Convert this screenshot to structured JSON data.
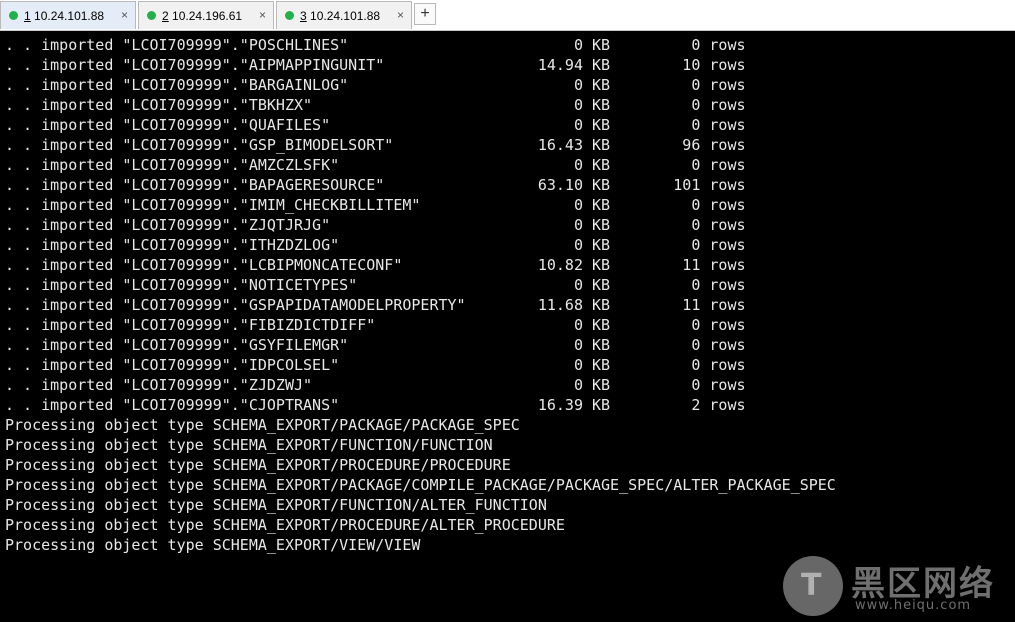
{
  "tabs": [
    {
      "num": "1",
      "host": "10.24.101.88",
      "status_color": "#22b04a",
      "active": true,
      "close": "×"
    },
    {
      "num": "2",
      "host": "10.24.196.61",
      "status_color": "#22b04a",
      "active": false,
      "close": "×"
    },
    {
      "num": "3",
      "host": "10.24.101.88",
      "status_color": "#22b04a",
      "active": false,
      "close": "×"
    }
  ],
  "add_tab_label": "+",
  "imports": [
    {
      "table": "POSCHLINES",
      "size": "0 KB",
      "rows": "0"
    },
    {
      "table": "AIPMAPPINGUNIT",
      "size": "14.94 KB",
      "rows": "10"
    },
    {
      "table": "BARGAINLOG",
      "size": "0 KB",
      "rows": "0"
    },
    {
      "table": "TBKHZX",
      "size": "0 KB",
      "rows": "0"
    },
    {
      "table": "QUAFILES",
      "size": "0 KB",
      "rows": "0"
    },
    {
      "table": "GSP_BIMODELSORT",
      "size": "16.43 KB",
      "rows": "96"
    },
    {
      "table": "AMZCZLSFK",
      "size": "0 KB",
      "rows": "0"
    },
    {
      "table": "BAPAGERESOURCE",
      "size": "63.10 KB",
      "rows": "101"
    },
    {
      "table": "IMIM_CHECKBILLITEM",
      "size": "0 KB",
      "rows": "0"
    },
    {
      "table": "ZJQTJRJG",
      "size": "0 KB",
      "rows": "0"
    },
    {
      "table": "ITHZDZLOG",
      "size": "0 KB",
      "rows": "0"
    },
    {
      "table": "LCBIPMONCATECONF",
      "size": "10.82 KB",
      "rows": "11"
    },
    {
      "table": "NOTICETYPES",
      "size": "0 KB",
      "rows": "0"
    },
    {
      "table": "GSPAPIDATAMODELPROPERTY",
      "size": "11.68 KB",
      "rows": "11"
    },
    {
      "table": "FIBIZDICTDIFF",
      "size": "0 KB",
      "rows": "0"
    },
    {
      "table": "GSYFILEMGR",
      "size": "0 KB",
      "rows": "0"
    },
    {
      "table": "IDPCOLSEL",
      "size": "0 KB",
      "rows": "0"
    },
    {
      "table": "ZJDZWJ",
      "size": "0 KB",
      "rows": "0"
    },
    {
      "table": "CJOPTRANS",
      "size": "16.39 KB",
      "rows": "2"
    }
  ],
  "import_prefix": ". . imported",
  "schema": "LCOI709999",
  "rows_suffix": "rows",
  "processing_prefix": "Processing object type",
  "processing": [
    "SCHEMA_EXPORT/PACKAGE/PACKAGE_SPEC",
    "SCHEMA_EXPORT/FUNCTION/FUNCTION",
    "SCHEMA_EXPORT/PROCEDURE/PROCEDURE",
    "SCHEMA_EXPORT/PACKAGE/COMPILE_PACKAGE/PACKAGE_SPEC/ALTER_PACKAGE_SPEC",
    "SCHEMA_EXPORT/FUNCTION/ALTER_FUNCTION",
    "SCHEMA_EXPORT/PROCEDURE/ALTER_PROCEDURE",
    "SCHEMA_EXPORT/VIEW/VIEW"
  ],
  "watermark": {
    "name": "黑区网络",
    "url": "www.heiqu.com"
  }
}
